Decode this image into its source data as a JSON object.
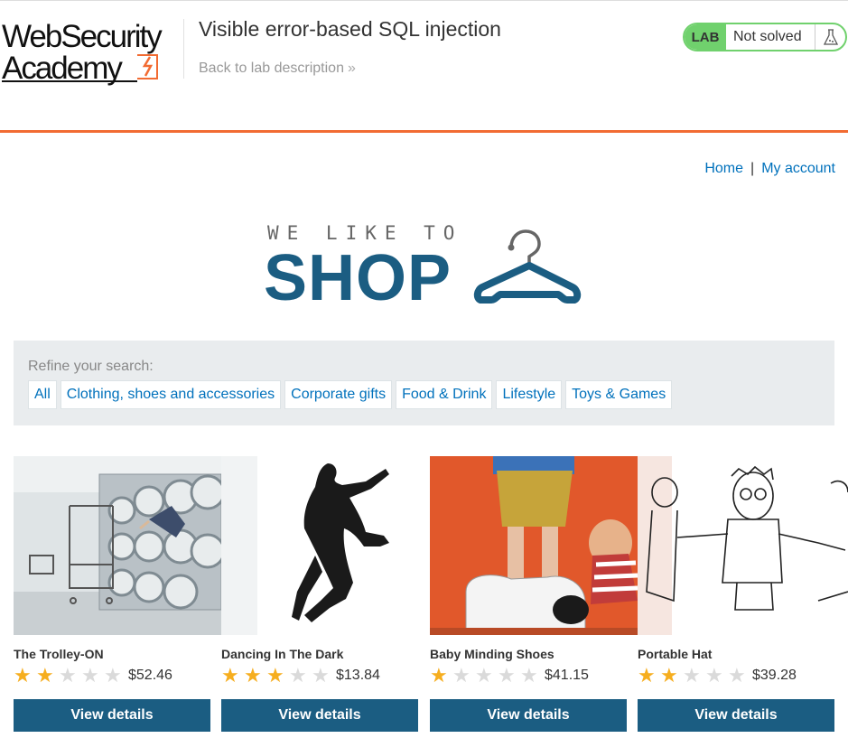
{
  "academy": {
    "logo_line1": "WebSecurity",
    "logo_line2": "Academy",
    "lab_title": "Visible error-based SQL injection",
    "back_link": "Back to lab description",
    "lab_tag": "LAB",
    "lab_status": "Not solved",
    "colors": {
      "accent": "#f26b32",
      "status_green": "#70d16d"
    }
  },
  "nav": {
    "home": "Home",
    "separator": "|",
    "my_account": "My account"
  },
  "shop_logo": {
    "tagline": "WE LIKE TO",
    "word": "SHOP",
    "icon": "hanger-icon",
    "color": "#1b5d82"
  },
  "filters": {
    "label": "Refine your search:",
    "categories": [
      "All",
      "Clothing, shoes and accessories",
      "Corporate gifts",
      "Food & Drink",
      "Lifestyle",
      "Toys & Games"
    ]
  },
  "products": [
    {
      "name": "The Trolley-ON",
      "rating": 2,
      "max_rating": 5,
      "price": "$52.46",
      "button": "View details",
      "image": "laundromat-photo"
    },
    {
      "name": "Dancing In The Dark",
      "rating": 3,
      "max_rating": 5,
      "price": "$13.84",
      "button": "View details",
      "image": "dancing-silhouette"
    },
    {
      "name": "Baby Minding Shoes",
      "rating": 1,
      "max_rating": 5,
      "price": "$41.15",
      "button": "View details",
      "image": "toy-figures-photo"
    },
    {
      "name": "Portable Hat",
      "rating": 2,
      "max_rating": 5,
      "price": "$39.28",
      "button": "View details",
      "image": "cartoon-sketch"
    }
  ]
}
